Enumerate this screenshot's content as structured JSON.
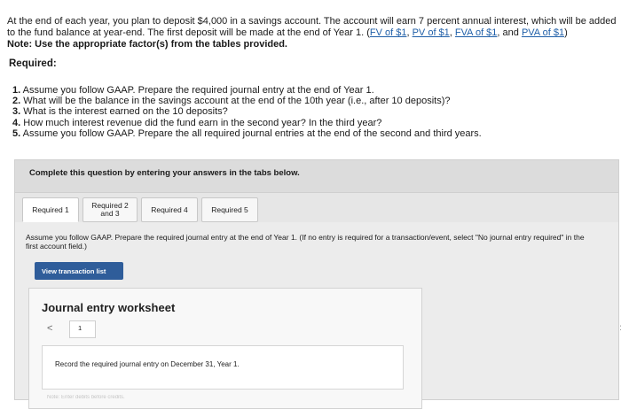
{
  "intro": {
    "text": "At the end of each year, you plan to deposit $4,000 in a savings account. The account will earn 7 percent annual interest, which will be added to the fund balance at year-end. The first deposit will be made at the end of Year 1. (",
    "links": [
      "FV of $1",
      "PV of $1",
      "FVA of $1",
      "PVA of $1"
    ],
    "sep1": ", ",
    "sep2": ", ",
    "sep3": ", and ",
    "tail": ")",
    "note": "Note: Use the appropriate factor(s) from the tables provided."
  },
  "required_heading": "Required:",
  "requirements": [
    {
      "num": "1.",
      "text": " Assume you follow GAAP. Prepare the required journal entry at the end of Year 1."
    },
    {
      "num": "2.",
      "text": " What will be the balance in the savings account at the end of the 10th year (i.e., after 10 deposits)?"
    },
    {
      "num": "3.",
      "text": " What is the interest earned on the 10 deposits?"
    },
    {
      "num": "4.",
      "text": " How much interest revenue did the fund earn in the second year? In the third year?"
    },
    {
      "num": "5.",
      "text": " Assume you follow GAAP. Prepare the all required journal entries at the end of the second and third years."
    }
  ],
  "complete_text": "Complete this question by entering your answers in the tabs below.",
  "tabs": [
    {
      "line1": "Required 1",
      "line2": ""
    },
    {
      "line1": "Required 2",
      "line2": "and 3"
    },
    {
      "line1": "Required 4",
      "line2": ""
    },
    {
      "line1": "Required 5",
      "line2": ""
    }
  ],
  "instruction": "Assume you follow GAAP. Prepare the required journal entry at the end of Year 1. (If no entry is required for a transaction/event, select \"No journal entry required\" in the first account field.)",
  "view_transaction_button": "View transaction list",
  "worksheet": {
    "title": "Journal entry worksheet",
    "page": "1",
    "prev_glyph": "<",
    "next_glyph": ">",
    "record_text": "Record the required journal entry on December 31, Year 1.",
    "footnote_fragment": "Note: Enter debits before credits."
  }
}
